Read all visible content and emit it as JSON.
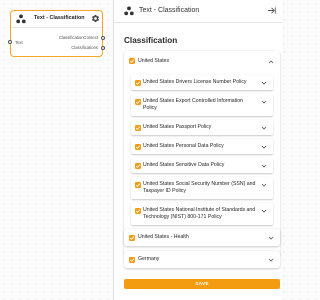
{
  "colors": {
    "accent": "#f39c12",
    "node_border": "#f5a623"
  },
  "node": {
    "icon": "hierarchy-icon",
    "title": "Text - Classification",
    "settings_icon": "gear-icon",
    "input_port_label": "Text",
    "output_ports": [
      "ClassificationContext",
      "Classifications"
    ]
  },
  "panel": {
    "header_icon": "hierarchy-icon",
    "title": "Text - Classification",
    "collapse_icon": "arrow-right-collapse-icon",
    "section_title": "Classification",
    "groups": [
      {
        "label": "United States",
        "checked": true,
        "expanded": true,
        "items": [
          {
            "label": "United States Drivers License Number Policy",
            "checked": true
          },
          {
            "label": "United States Export Controlled Information Policy",
            "checked": true
          },
          {
            "label": "United States Passport Policy",
            "checked": true
          },
          {
            "label": "United States Personal Data Policy",
            "checked": true
          },
          {
            "label": "United States Sensitive Data Policy",
            "checked": true
          },
          {
            "label": "United States Social Security Number (SSN) and Taxpayer ID Policy",
            "checked": true
          },
          {
            "label": "United States National Institute of Standards and Technology (NIST) 800-171 Policy",
            "checked": true
          }
        ]
      },
      {
        "label": "United States - Health",
        "checked": true,
        "expanded": false,
        "items": []
      },
      {
        "label": "Germany",
        "checked": true,
        "expanded": false,
        "items": []
      }
    ],
    "save_label": "SAVE"
  }
}
